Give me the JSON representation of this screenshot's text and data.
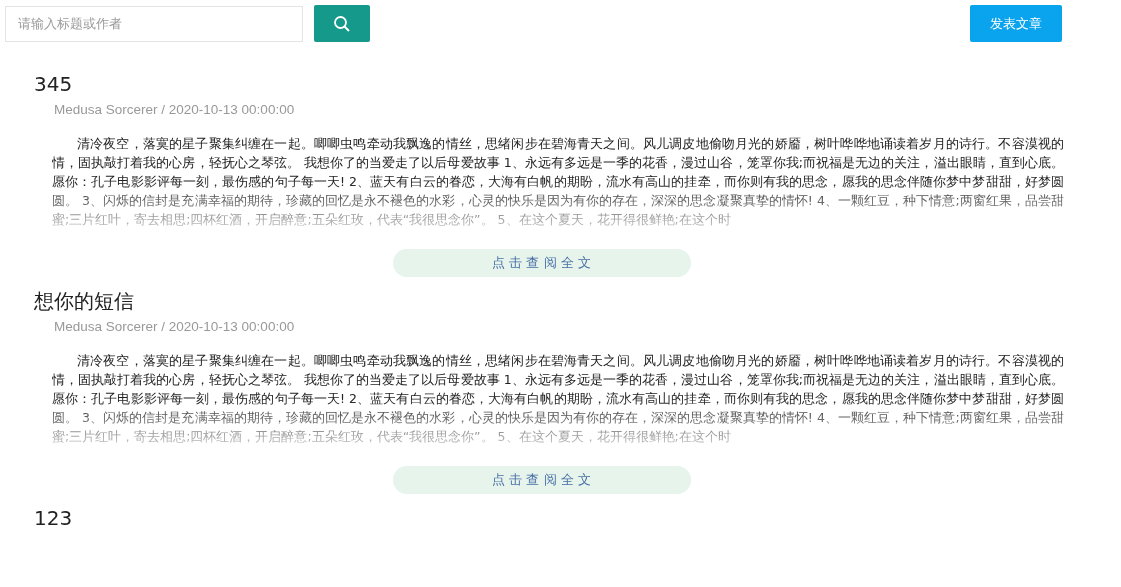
{
  "search": {
    "placeholder": "请输入标题或作者"
  },
  "publish_button": "发表文章",
  "articles": [
    {
      "title": "345",
      "meta": "Medusa Sorcerer / 2020-10-13 00:00:00",
      "body": "清冷夜空，落寞的星子聚集纠缠在一起。唧唧虫鸣牵动我飘逸的情丝，思绪闲步在碧海青天之间。风儿调皮地偷吻月光的娇靥，树叶哗哗地诵读着岁月的诗行。不容漠视的情，固执敲打着我的心房，轻抚心之琴弦。 我想你了的当爱走了以后母爱故事 1、永远有多远是一季的花香，漫过山谷，笼罩你我;而祝福是无边的关注，溢出眼睛，直到心底。愿你：孔子电影影评每一刻，最伤感的句子每一天! 2、蓝天有白云的眷恋，大海有白帆的期盼，流水有高山的挂牵，而你则有我的思念，愿我的思念伴随你梦中梦甜甜，好梦圆圆。 3、闪烁的信封是充满幸福的期待，珍藏的回忆是永不褪色的水彩，心灵的快乐是因为有你的存在，深深的思念凝聚真挚的情怀! 4、一颗红豆，种下情意;两窗红果，品尝甜蜜;三片红叶，寄去相思;四杯红酒，开启醉意;五朵红玫，代表“我很思念你”。 5、在这个夏天，花开得很鲜艳;在这个时",
      "read_more": "点 击 查 阅 全 文"
    },
    {
      "title": "想你的短信",
      "meta": "Medusa Sorcerer / 2020-10-13 00:00:00",
      "body": "清冷夜空，落寞的星子聚集纠缠在一起。唧唧虫鸣牵动我飘逸的情丝，思绪闲步在碧海青天之间。风儿调皮地偷吻月光的娇靥，树叶哗哗地诵读着岁月的诗行。不容漠视的情，固执敲打着我的心房，轻抚心之琴弦。 我想你了的当爱走了以后母爱故事 1、永远有多远是一季的花香，漫过山谷，笼罩你我;而祝福是无边的关注，溢出眼睛，直到心底。愿你：孔子电影影评每一刻，最伤感的句子每一天! 2、蓝天有白云的眷恋，大海有白帆的期盼，流水有高山的挂牵，而你则有我的思念，愿我的思念伴随你梦中梦甜甜，好梦圆圆。 3、闪烁的信封是充满幸福的期待，珍藏的回忆是永不褪色的水彩，心灵的快乐是因为有你的存在，深深的思念凝聚真挚的情怀! 4、一颗红豆，种下情意;两窗红果，品尝甜蜜;三片红叶，寄去相思;四杯红酒，开启醉意;五朵红玫，代表“我很思念你”。 5、在这个夏天，花开得很鲜艳;在这个时",
      "read_more": "点 击 查 阅 全 文"
    },
    {
      "title": "123"
    }
  ]
}
